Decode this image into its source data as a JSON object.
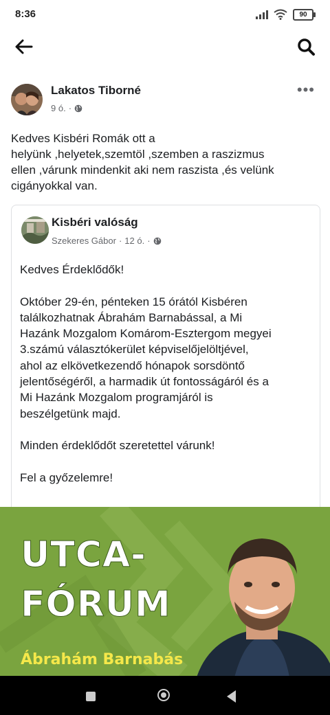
{
  "status": {
    "time": "8:36",
    "battery": "90"
  },
  "post": {
    "author": "Lakatos Tiborné",
    "time": "9 ó.",
    "separator": "·",
    "text_lines": [
      "Kedves Kisbéri Romák ott a",
      "helyünk ,helyetek,szemtöl ,szemben a raszizmus",
      "ellen ,várunk mindenkit aki nem raszista  ,és velünk",
      "cigányokkal van."
    ]
  },
  "shared": {
    "page_name": "Kisbéri valóság",
    "poster": "Szekeres Gábor",
    "time": "12 ó.",
    "separator": "·",
    "greeting": "Kedves Érdeklődők!",
    "body_lines": [
      "Október 29-én, pénteken 15 órától Kisbéren",
      "találkozhatnak Ábrahám Barnabással, a Mi",
      "Hazánk Mozgalom Komárom-Esztergom megyei",
      "3.számú választókerület képviselőjelöltjével,",
      "ahol az elkövetkezendő hónapok sorsdöntő",
      "jelentőségéről, a harmadik út fontosságáról és a",
      "Mi Hazánk Mozgalom programjáról is",
      "beszélgetünk majd."
    ],
    "invite": "Minden érdeklődőt szeretettel várunk!",
    "closing": "Fel a győzelemre!"
  },
  "banner": {
    "title_line1": "UTCA-",
    "title_line2": "FÓRUM",
    "name": "Ábrahám Barnabás"
  },
  "icons": {
    "back": "arrow-left-icon",
    "search": "search-icon",
    "more": "more-dots-icon",
    "privacy": "globe-icon"
  },
  "colors": {
    "banner_green": "#7aa43f",
    "banner_name_yellow": "#f5e84a",
    "meta_gray": "#65676b"
  }
}
